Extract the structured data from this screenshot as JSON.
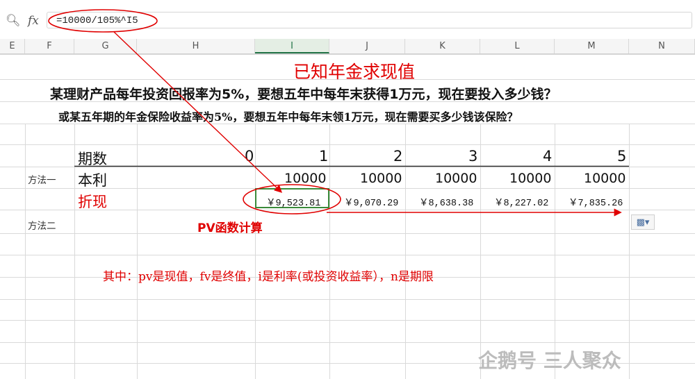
{
  "formula_bar": {
    "fx_label": "fx",
    "formula": "=10000/105%^I5"
  },
  "columns": [
    "E",
    "F",
    "G",
    "H",
    "I",
    "J",
    "K",
    "L",
    "M",
    "N"
  ],
  "title": "已知年金求现值",
  "question1": "某理财产品每年投资回报率为5%，要想五年中每年末获得1万元，现在要投入多少钱？",
  "question2": "或某五年期的年金保险收益率为5%，要想五年中每年末领1万元，现在需要买多少钱该保险？",
  "table": {
    "period_label": "期数",
    "periods": [
      "0",
      "1",
      "2",
      "3",
      "4",
      "5"
    ],
    "principal_label": "本利",
    "principal": [
      "10000",
      "10000",
      "10000",
      "10000",
      "10000"
    ],
    "discount_label": "折现",
    "discount": [
      "￥9,523.81",
      "￥9,070.29",
      "￥8,638.38",
      "￥8,227.02",
      "￥7,835.26"
    ]
  },
  "method1": "方法一",
  "method2": "方法二",
  "pv_note": "PV函数计算",
  "explanation": "其中：pv是现值，fv是终值，i是利率(或投资收益率），n是期限",
  "watermark": "企鹅号 三人聚众",
  "colors": {
    "accent_red": "#e00000",
    "selection_green": "#217346",
    "grid": "#d9d9d9"
  }
}
